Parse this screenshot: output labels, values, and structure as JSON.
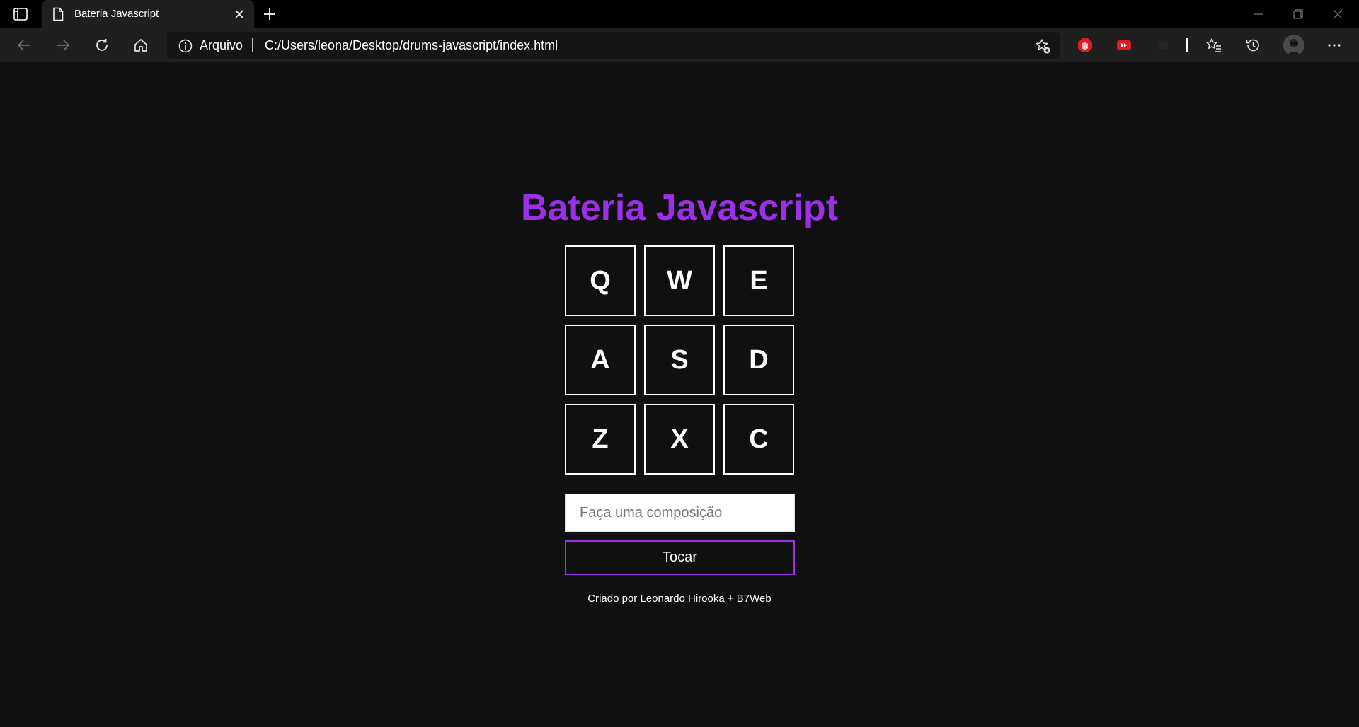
{
  "browser": {
    "tab": {
      "title": "Bateria Javascript"
    },
    "address_bar": {
      "site_label": "Arquivo",
      "url": "C:/Users/leona/Desktop/drums-javascript/index.html"
    }
  },
  "icons": {
    "tab_actions": "tab-actions-icon",
    "page": "page-icon",
    "close_tab": "close-icon",
    "new_tab": "plus-icon",
    "back": "back-arrow-icon",
    "forward": "forward-arrow-icon",
    "refresh": "refresh-icon",
    "home": "home-icon",
    "info": "info-icon",
    "add_favorite": "star-add-icon",
    "extensions": [
      "adblock-extension-icon",
      "youtube-extension-icon",
      "extension-icon"
    ],
    "favorites": "favorites-icon",
    "history": "history-icon",
    "profile": "avatar",
    "more": "more-icon"
  },
  "colors": {
    "accent": "#9b30e8",
    "background": "#101010",
    "key_border": "#ffffff"
  },
  "page": {
    "title": "Bateria Javascript",
    "keys": [
      "Q",
      "W",
      "E",
      "A",
      "S",
      "D",
      "Z",
      "X",
      "C"
    ],
    "composer": {
      "placeholder": "Faça uma composição",
      "value": ""
    },
    "play_button": "Tocar",
    "footer": "Criado por Leonardo Hirooka + B7Web"
  }
}
